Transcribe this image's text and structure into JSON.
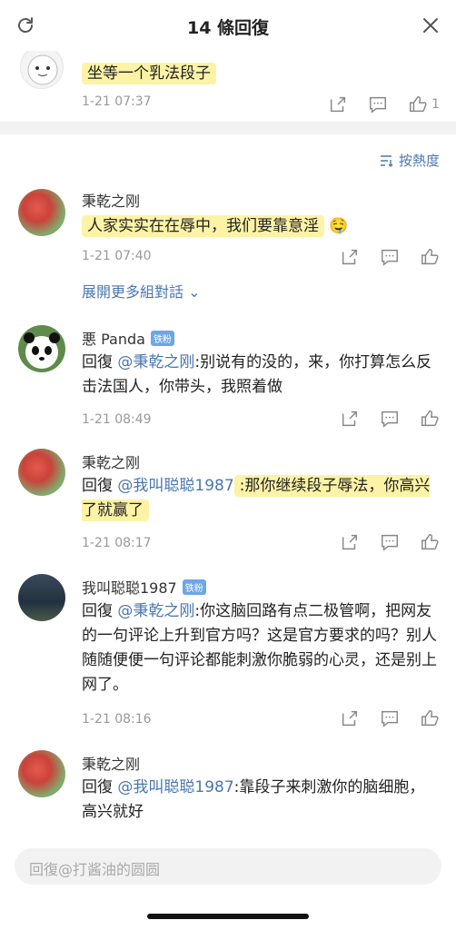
{
  "header": {
    "title": "14 條回復"
  },
  "top_comment": {
    "author_partial": "打酱油的圆圆",
    "text": "坐等一个乳法段子",
    "time": "1-21 07:37",
    "likes": "1"
  },
  "sort": {
    "label": "按熱度"
  },
  "comments": [
    {
      "author": "秉乾之刚",
      "badge": "",
      "text": "人家实实在在辱中，我们要靠意淫",
      "reply_to": "",
      "time": "1-21 07:40",
      "expand_label": "展開更多組對話"
    },
    {
      "author": "悪 Panda",
      "badge": "铁粉",
      "reply_prefix": "回復",
      "reply_to": "@秉乾之刚",
      "text": ":别说有的没的，来，你打算怎么反击法国人，你带头，我照着做",
      "time": "1-21 08:49"
    },
    {
      "author": "秉乾之刚",
      "badge": "",
      "reply_prefix": "回復",
      "reply_to": "@我叫聪聪1987",
      "text": ":那你继续段子辱法，你高兴了就赢了",
      "time": "1-21 08:17"
    },
    {
      "author": "我叫聪聪1987",
      "badge": "铁粉",
      "reply_prefix": "回復",
      "reply_to": "@秉乾之刚",
      "text": ":你这脑回路有点二极管啊，把网友的一句评论上升到官方吗？这是官方要求的吗？别人随随便便一句评论都能刺激你脆弱的心灵，还是别上网了。",
      "time": "1-21 08:16"
    },
    {
      "author": "秉乾之刚",
      "badge": "",
      "reply_prefix": "回復",
      "reply_to": "@我叫聪聪1987",
      "text": ":靠段子来刺激你的脑细胞，高兴就好",
      "time": ""
    }
  ],
  "reply_input": {
    "placeholder": "回復@打酱油的圆圆"
  },
  "colors": {
    "link": "#4a77b0",
    "highlight": "#fdf3a6",
    "badge": "#6ea6e7"
  }
}
